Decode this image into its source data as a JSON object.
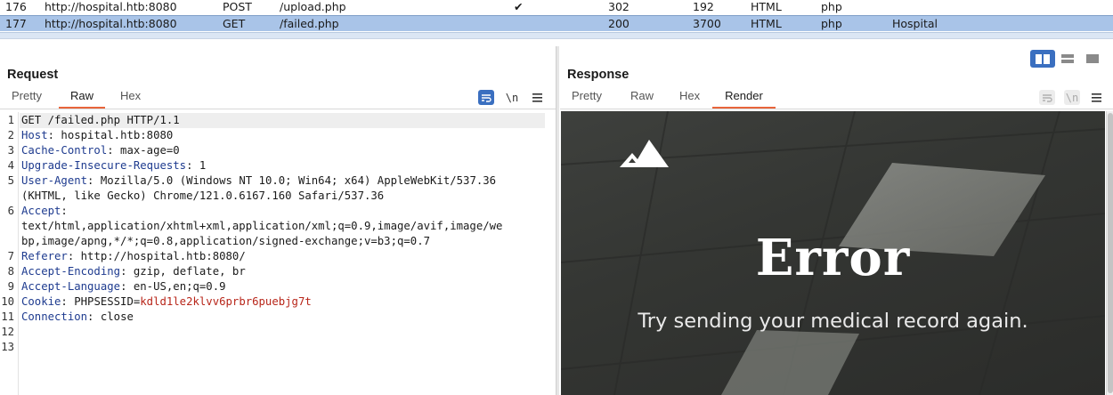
{
  "history": {
    "rows": [
      {
        "id": "176",
        "host": "http://hospital.htb:8080",
        "method": "POST",
        "url": "/upload.php",
        "check": "✔",
        "status": "302",
        "length": "192",
        "mime": "HTML",
        "ext": "php",
        "title": ""
      },
      {
        "id": "177",
        "host": "http://hospital.htb:8080",
        "method": "GET",
        "url": "/failed.php",
        "check": "",
        "status": "200",
        "length": "3700",
        "mime": "HTML",
        "ext": "php",
        "title": "Hospital"
      }
    ]
  },
  "request": {
    "title": "Request",
    "tabs": [
      "Pretty",
      "Raw",
      "Hex"
    ],
    "active_tab": "Raw",
    "newline_toggle": "\\n",
    "lines": [
      {
        "n": "1",
        "key": "",
        "val": "GET /failed.php HTTP/1.1"
      },
      {
        "n": "2",
        "key": "Host",
        "val": " hospital.htb:8080"
      },
      {
        "n": "3",
        "key": "Cache-Control",
        "val": " max-age=0"
      },
      {
        "n": "4",
        "key": "Upgrade-Insecure-Requests",
        "val": " 1"
      },
      {
        "n": "5",
        "key": "User-Agent",
        "val": " Mozilla/5.0 (Windows NT 10.0; Win64; x64) AppleWebKit/537.36"
      },
      {
        "n": "",
        "key": "",
        "val": "(KHTML, like Gecko) Chrome/121.0.6167.160 Safari/537.36"
      },
      {
        "n": "6",
        "key": "Accept",
        "val": ""
      },
      {
        "n": "",
        "key": "",
        "val": "text/html,application/xhtml+xml,application/xml;q=0.9,image/avif,image/we"
      },
      {
        "n": "",
        "key": "",
        "val": "bp,image/apng,*/*;q=0.8,application/signed-exchange;v=b3;q=0.7"
      },
      {
        "n": "7",
        "key": "Referer",
        "val": " http://hospital.htb:8080/"
      },
      {
        "n": "8",
        "key": "Accept-Encoding",
        "val": " gzip, deflate, br"
      },
      {
        "n": "9",
        "key": "Accept-Language",
        "val": " en-US,en;q=0.9"
      },
      {
        "n": "10",
        "key": "Cookie",
        "val": " PHPSESSID=",
        "cookie": "kdld1le2klvv6prbr6puebjg7t"
      },
      {
        "n": "11",
        "key": "Connection",
        "val": " close"
      },
      {
        "n": "12",
        "key": "",
        "val": ""
      },
      {
        "n": "13",
        "key": "",
        "val": ""
      }
    ]
  },
  "response": {
    "title": "Response",
    "tabs": [
      "Pretty",
      "Raw",
      "Hex",
      "Render"
    ],
    "active_tab": "Render",
    "newline_toggle": "\\n",
    "render": {
      "heading": "Error",
      "message": "Try sending your medical record again."
    }
  },
  "colors": {
    "accent": "#e8653b",
    "selected_row": "#a9c4e8",
    "header_key": "#1e3b8f",
    "cookie_value": "#b8261a"
  }
}
